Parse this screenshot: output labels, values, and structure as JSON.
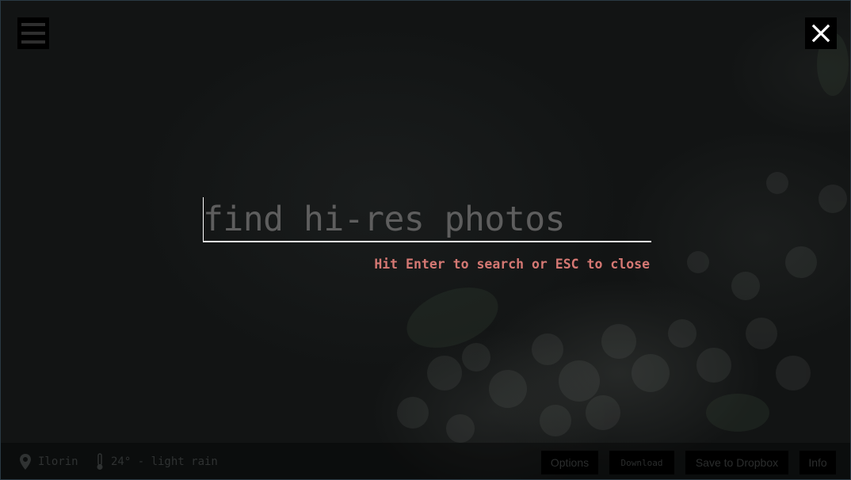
{
  "header": {
    "menu_icon": "hamburger-menu-icon",
    "close_icon": "close-x-icon"
  },
  "search": {
    "placeholder": "find hi-res photos",
    "value": "",
    "hint": "Hit Enter to search or ESC to close"
  },
  "footer": {
    "location": {
      "icon": "map-pin-icon",
      "label": "Ilorin"
    },
    "weather": {
      "icon": "thermometer-icon",
      "label": "24° - light rain"
    },
    "buttons": {
      "options": "Options",
      "download": "Download",
      "dropbox": "Save to Dropbox",
      "info": "Info"
    }
  },
  "colors": {
    "hint_text": "#d57873",
    "overlay": "#121414",
    "button_bg": "#000000"
  }
}
